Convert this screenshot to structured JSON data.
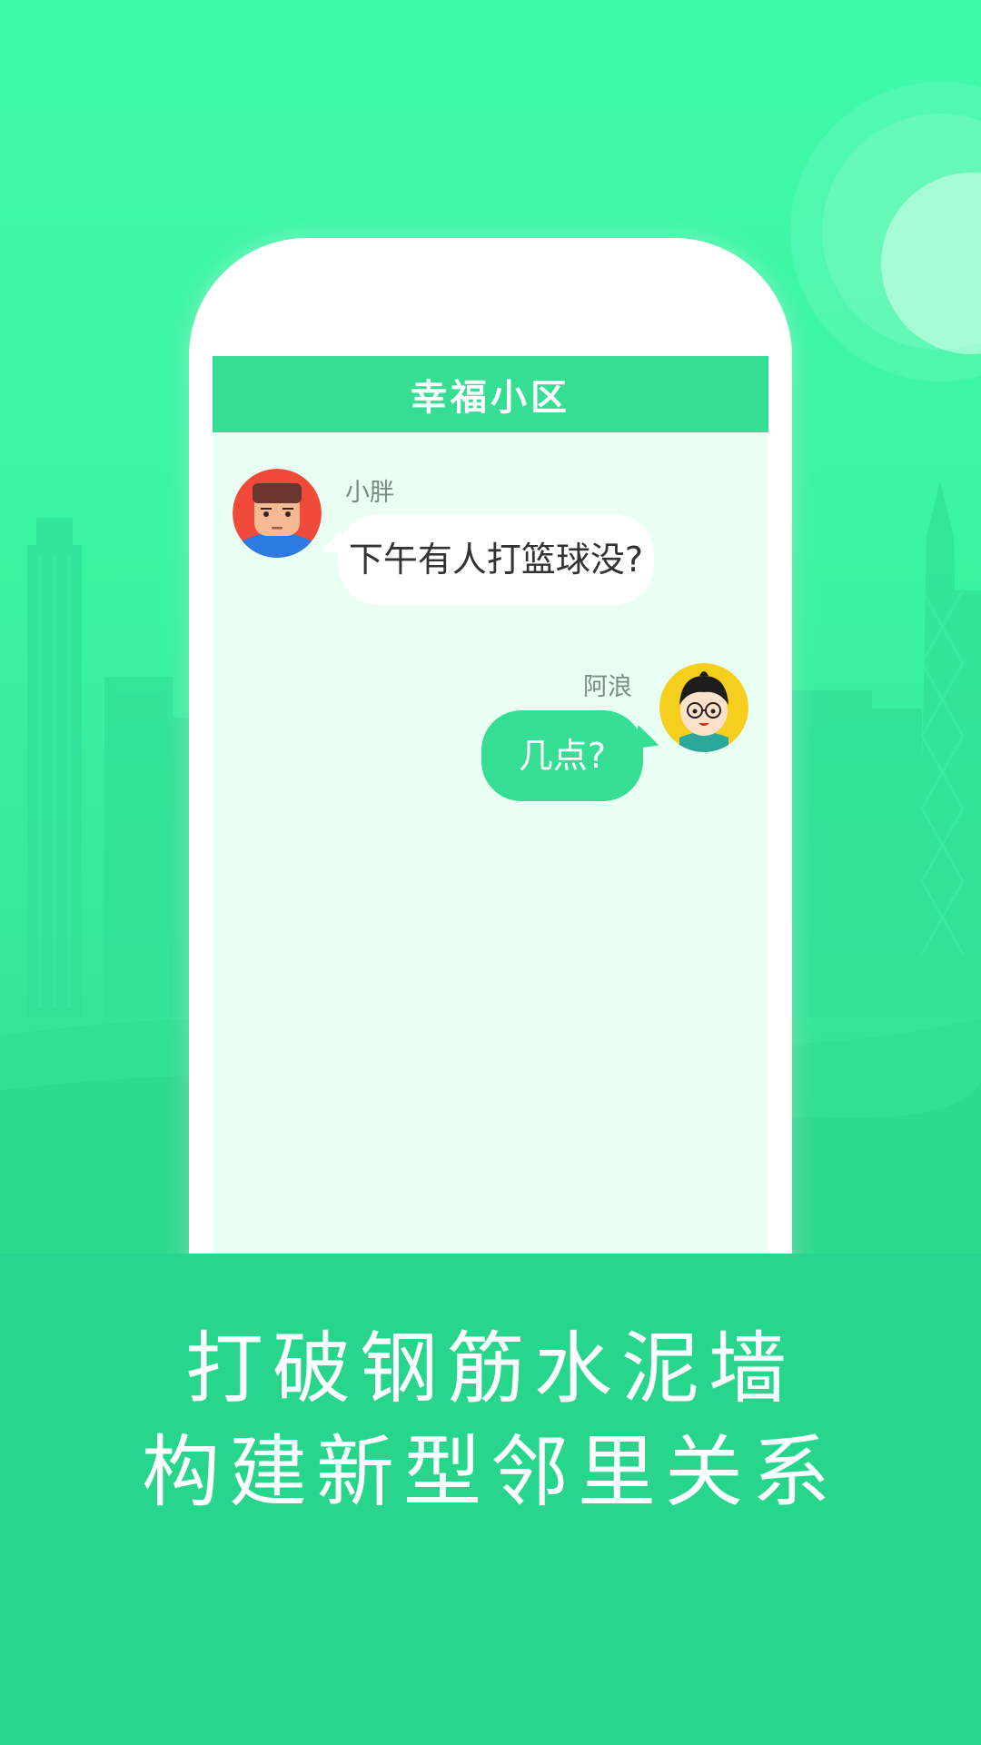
{
  "colors": {
    "background_top": "#3ffaa8",
    "background_bottom": "#30dc8f",
    "accent": "#35de93",
    "bottom_band": "#27d68c",
    "chat_background": "#e9fff4"
  },
  "chat": {
    "title": "幸福小区",
    "messages": [
      {
        "sender": "小胖",
        "text": "下午有人打篮球没?",
        "side": "left",
        "avatar": "boy-red-avatar"
      },
      {
        "sender": "阿浪",
        "text": "几点?",
        "side": "right",
        "avatar": "boy-glasses-avatar"
      }
    ]
  },
  "slogan": {
    "line1": "打破钢筋水泥墙",
    "line2": "构建新型邻里关系"
  }
}
